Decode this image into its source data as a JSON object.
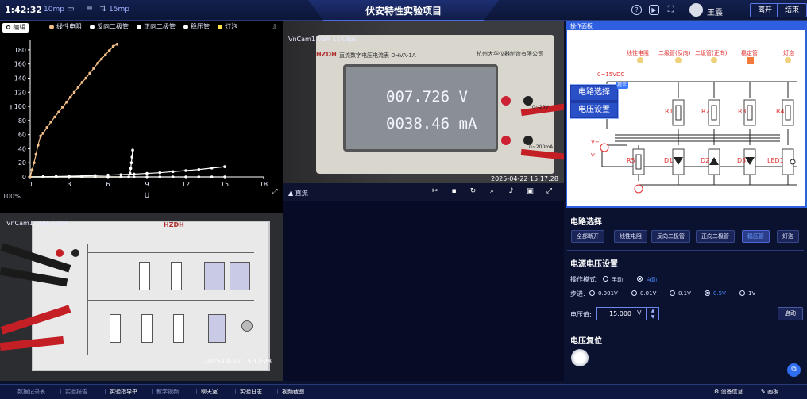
{
  "topbar": {
    "time": "1:42:32",
    "fps": "10mp",
    "net": "15mp",
    "title": "伏安特性实验项目",
    "user": "王震",
    "btn_leave": "离开",
    "btn_end": "结束"
  },
  "chart_panel": {
    "tag": "编辑",
    "zoom": "100%"
  },
  "chart_data": {
    "type": "line",
    "title": "",
    "xlabel": "U",
    "ylabel": "I",
    "xlim": [
      0,
      18
    ],
    "ylim": [
      0,
      190
    ],
    "x_ticks": [
      0,
      3,
      6,
      9,
      12,
      15,
      18
    ],
    "y_ticks": [
      0,
      20,
      40,
      60,
      80,
      100,
      120,
      140,
      160,
      180
    ],
    "grid": false,
    "legend_position": "top",
    "series": [
      {
        "name": "线性电阻",
        "color": "#f2c088",
        "x": [
          0,
          0.15,
          0.3,
          0.45,
          0.6,
          0.8,
          1.0,
          1.3,
          1.6,
          1.9,
          2.2,
          2.5,
          2.8,
          3.1,
          3.4,
          3.7,
          4.0,
          4.3,
          4.6,
          4.9,
          5.2,
          5.5,
          5.8,
          6.1,
          6.4,
          6.7
        ],
        "y": [
          0,
          10,
          20,
          32,
          45,
          58,
          62,
          70,
          78,
          85,
          92,
          99,
          106,
          113,
          120,
          127,
          134,
          140,
          147,
          154,
          161,
          167,
          173,
          179,
          185,
          188
        ]
      },
      {
        "name": "反向二极管",
        "color": "#ffffff",
        "x": [
          0,
          1,
          2,
          3,
          4,
          5,
          6,
          7,
          8,
          9,
          10,
          11,
          12,
          13,
          14,
          15
        ],
        "y": [
          0,
          0,
          0,
          0,
          0,
          0,
          0,
          0,
          0,
          0,
          0,
          0,
          0,
          0,
          0,
          0
        ]
      },
      {
        "name": "正向二极管",
        "color": "#ffffff",
        "x": [
          0,
          1,
          2,
          3,
          4,
          5,
          6,
          7,
          8,
          9,
          10,
          11,
          12,
          13,
          14,
          15
        ],
        "y": [
          0,
          0.3,
          0.6,
          1,
          1.4,
          2,
          2.6,
          3.2,
          4,
          5,
          6,
          7.5,
          9,
          10.5,
          12.5,
          14.5
        ]
      },
      {
        "name": "稳压管",
        "color": "#ffffff",
        "x": [
          0,
          1,
          2,
          3,
          4,
          5,
          6,
          7,
          7.6,
          7.7,
          7.75,
          7.8,
          7.85,
          7.9
        ],
        "y": [
          0,
          0,
          0,
          0,
          0,
          0,
          0,
          0,
          0,
          5,
          12,
          20,
          28,
          38
        ]
      },
      {
        "name": "灯泡",
        "color": "#ffe24a",
        "x": [
          0,
          1,
          2,
          3,
          4,
          5,
          6,
          7
        ],
        "y": [
          0,
          0,
          0,
          0,
          0,
          0,
          0,
          0
        ]
      }
    ]
  },
  "cam1": {
    "label": "VnCam1  VBR  11KBps",
    "brand": "HZDH",
    "model": "直流数字电压电流表 DHVA-1A",
    "maker": "杭州大华仪器制造有限公司",
    "voltage": "007.726 V",
    "current": "0038.46 mA",
    "jack1": "0~20V",
    "jack2": "0~200mA",
    "stamp": "2025-04-22   15:17:28",
    "corner": "▲ 直流"
  },
  "cam2": {
    "label": "VnCam1  VBR  22KB",
    "brand": "HZDH",
    "stamp": "2025-04-22   15:17:28"
  },
  "circuit": {
    "head": "操作面板",
    "labels": [
      "线性电阻",
      "二级管(反向)",
      "二级管(正向)",
      "稳定管",
      "灯泡"
    ],
    "source": "0~15VDC",
    "upper": [
      "R1",
      "R2",
      "R3",
      "R4"
    ],
    "lower": [
      "R5",
      "D1",
      "D2",
      "D3",
      "LED1"
    ],
    "vplus": "V+",
    "vminus": "V-",
    "menu_badge": "提示",
    "menu": [
      "电路选择",
      "电压设置"
    ]
  },
  "controls": {
    "circuit_title": "电路选择",
    "circuit_buttons": [
      "全部断开",
      "线性电阻",
      "反向二极管",
      "正向二极管",
      "稳压管",
      "灯泡"
    ],
    "active_button": 4,
    "voltage_title": "电源电压设置",
    "mode_label": "操作模式:",
    "modes": [
      "手动",
      "自动"
    ],
    "step_label": "步进:",
    "steps": [
      "0.001V",
      "0.01V",
      "0.1V",
      "0.5V",
      "1V"
    ],
    "voltage_label": "电压值:",
    "voltage_value": "15.000",
    "voltage_unit": "V",
    "start": "启动",
    "reset_title": "电压复位"
  },
  "bottombar": {
    "items": [
      "数据记录表",
      "实验报告",
      "实验指导书",
      "教学视频",
      "聊天室",
      "实验日志",
      "视频截图"
    ],
    "bright": [
      false,
      false,
      true,
      false,
      true,
      true,
      true
    ],
    "right1": "设备信息",
    "right2": "画板"
  }
}
